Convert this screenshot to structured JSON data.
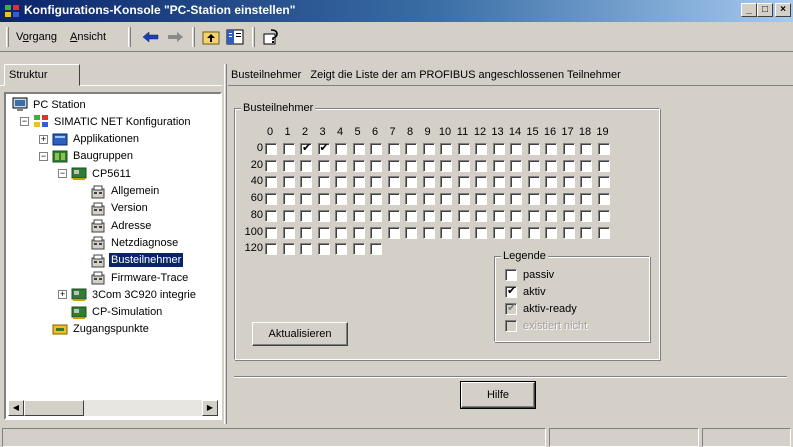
{
  "window": {
    "title": "Konfigurations-Konsole \"PC-Station einstellen\"",
    "buttons": {
      "minimize": "_",
      "maximize": "□",
      "close": "×"
    }
  },
  "menu": {
    "items": [
      "Vorgang",
      "Ansicht"
    ],
    "mnemonics": [
      "o",
      "A"
    ]
  },
  "toolbar": {
    "icons": [
      "back-arrow-icon",
      "forward-arrow-icon",
      "up-folder-icon",
      "show-hide-tree-icon",
      "help-icon"
    ]
  },
  "left_panel": {
    "tab_label": "Struktur",
    "tree": [
      {
        "label": "PC Station",
        "icon": "monitor-icon"
      },
      {
        "label": "SIMATIC NET Konfiguration",
        "icon": "network-icon"
      },
      {
        "label": "Applikationen",
        "icon": "applications-icon"
      },
      {
        "label": "Baugruppen",
        "icon": "modules-icon"
      },
      {
        "label": "CP5611",
        "icon": "card-icon"
      },
      {
        "label": "Allgemein",
        "icon": "properties-icon"
      },
      {
        "label": "Version",
        "icon": "properties-icon"
      },
      {
        "label": "Adresse",
        "icon": "properties-icon"
      },
      {
        "label": "Netzdiagnose",
        "icon": "properties-icon"
      },
      {
        "label": "Busteilnehmer",
        "icon": "properties-icon",
        "selected": true
      },
      {
        "label": "Firmware-Trace",
        "icon": "properties-icon"
      },
      {
        "label": "3Com 3C920 integrie",
        "icon": "card-icon"
      },
      {
        "label": "CP-Simulation",
        "icon": "card-icon"
      },
      {
        "label": "Zugangspunkte",
        "icon": "access-point-icon"
      }
    ]
  },
  "right_panel": {
    "header_title": "Busteilnehmer",
    "header_desc": "Zeigt die Liste der am PROFIBUS angeschlossenen Teilnehmer",
    "group_label": "Busteilnehmer",
    "columns": [
      "0",
      "1",
      "2",
      "3",
      "4",
      "5",
      "6",
      "7",
      "8",
      "9",
      "10",
      "11",
      "12",
      "13",
      "14",
      "15",
      "16",
      "17",
      "18",
      "19"
    ],
    "rows": [
      {
        "label": "0",
        "count": 20,
        "checked": [
          2,
          3
        ]
      },
      {
        "label": "20",
        "count": 20,
        "checked": []
      },
      {
        "label": "40",
        "count": 20,
        "checked": []
      },
      {
        "label": "60",
        "count": 20,
        "checked": []
      },
      {
        "label": "80",
        "count": 20,
        "checked": []
      },
      {
        "label": "100",
        "count": 20,
        "checked": []
      },
      {
        "label": "120",
        "count": 7,
        "checked": []
      }
    ],
    "legend_label": "Legende",
    "legend": [
      {
        "label": "passiv",
        "checked": false,
        "disabled": false
      },
      {
        "label": "aktiv",
        "checked": true,
        "disabled": false
      },
      {
        "label": "aktiv-ready",
        "checked": true,
        "disabled": false,
        "grey": true
      },
      {
        "label": "existiert nicht",
        "checked": false,
        "disabled": true,
        "grey": true
      }
    ],
    "refresh_button": "Aktualisieren",
    "help_button": "Hilfe"
  }
}
